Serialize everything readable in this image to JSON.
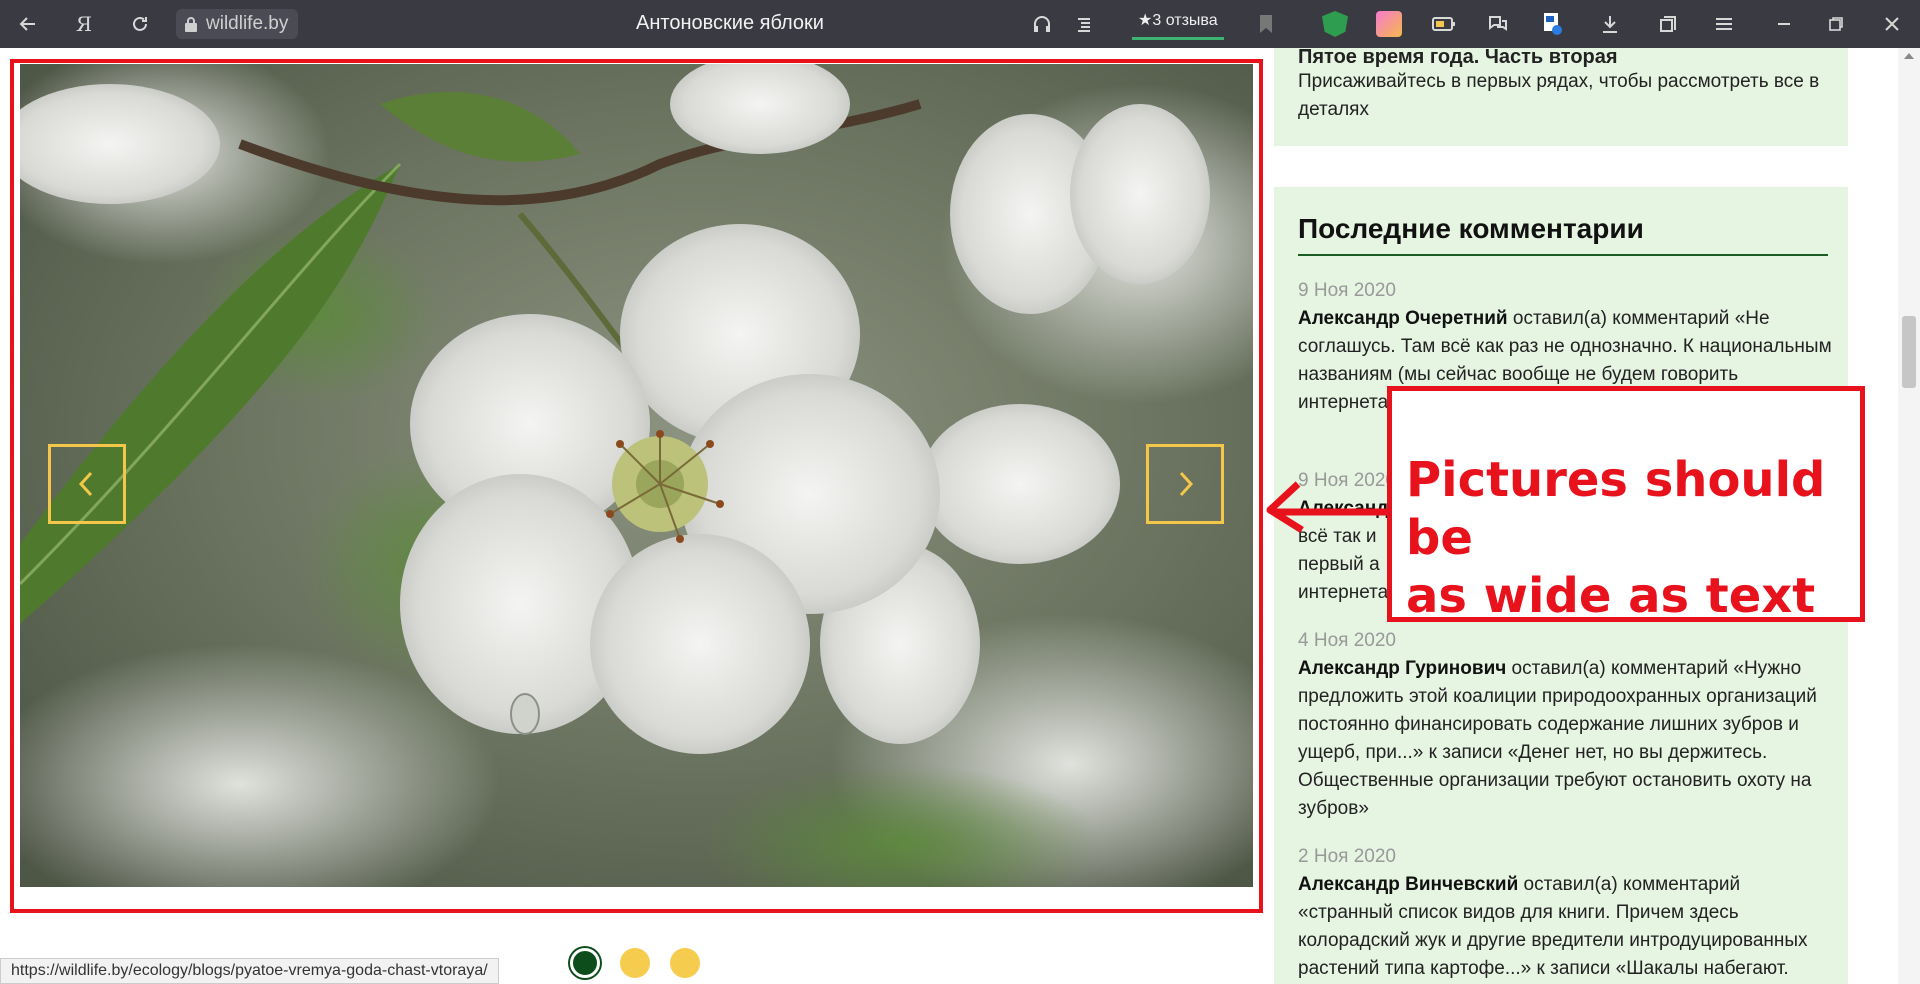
{
  "browser": {
    "url": "wildlife.by",
    "title": "Антоновские яблоки",
    "reviews_label": "★3 отзыва",
    "status_url": "https://wildlife.by/ecology/blogs/pyatoe-vremya-goda-chast-vtoraya/"
  },
  "slider": {
    "prev_icon": "chevron-left-icon",
    "next_icon": "chevron-right-icon",
    "dots": [
      "active",
      "inactive",
      "inactive"
    ],
    "accent": "#f4c64a"
  },
  "annotation": {
    "text_line1": "Pictures should be",
    "text_line2": "as wide as text",
    "color": "#e8121c"
  },
  "sidebar": {
    "prev_post": {
      "title": "Пятое время года. Часть вторая",
      "desc": "Присаживайтесь в первых рядах, чтобы рассмотреть все в деталях"
    },
    "comments_title": "Последние комментарии",
    "comments": [
      {
        "date": "9 Ноя 2020",
        "author": "Александр Очеретний",
        "text": " оставил(а) комментарий «Не соглашусь. Там всё как раз не однозначно. К национальным названиям (мы сейчас вообще не будем говорить",
        "tail": "интернета"
      },
      {
        "date": "9 Ноя 2020",
        "author": "Александр",
        "text": "",
        "line2": "всё так и",
        "line3": "первый а",
        "line4": "интернета"
      },
      {
        "date": "4 Ноя 2020",
        "author": "Александр Гуринович",
        "text": " оставил(а) комментарий «Нужно предложить этой коалиции природоохранных организаций постоянно финансировать содержание лишних зубров и ущерб, при...» к записи «Денег нет, но вы держитесь. Общественные организации требуют остановить охоту на зубров»"
      },
      {
        "date": "2 Ноя 2020",
        "author": "Александр Винчевский",
        "text": " оставил(а) комментарий «странный список видов для книги. Причем здесь колорадский жук и другие вредители интродуцированных растений типа картофе...» к записи «Шакалы набегают."
      }
    ]
  }
}
